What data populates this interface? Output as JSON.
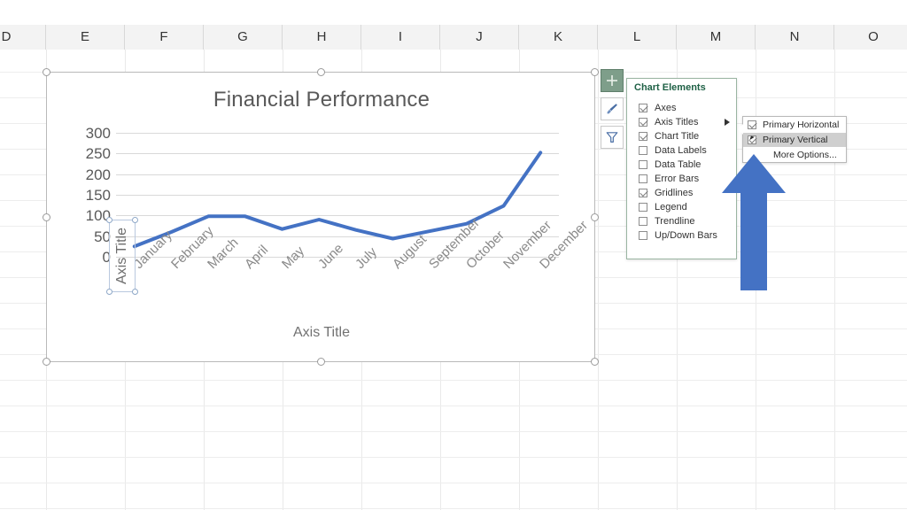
{
  "spreadsheet": {
    "column_headers": [
      "D",
      "E",
      "F",
      "G",
      "H",
      "I",
      "J",
      "K",
      "L",
      "M",
      "N",
      "O"
    ]
  },
  "chart": {
    "title": "Financial Performance",
    "x_axis_title": "Axis Title",
    "y_axis_title": "Axis Title",
    "y_axis_title_selected": true
  },
  "chart_data": {
    "type": "line",
    "title": "Financial Performance",
    "xlabel": "Axis Title",
    "ylabel": "Axis Title",
    "categories": [
      "January",
      "February",
      "March",
      "April",
      "May",
      "June",
      "July",
      "August",
      "September",
      "October",
      "November",
      "December"
    ],
    "values": [
      25,
      60,
      98,
      98,
      67,
      90,
      65,
      44,
      62,
      80,
      123,
      252
    ],
    "ylim": [
      0,
      300
    ],
    "yticks": [
      "0",
      "50",
      "100",
      "150",
      "200",
      "250",
      "300"
    ],
    "grid": true,
    "legend": "none",
    "series_color": "#4472C4"
  },
  "side_buttons": [
    {
      "name": "chart-elements",
      "icon": "plus-icon",
      "active": true
    },
    {
      "name": "chart-styles",
      "icon": "paintbrush-icon",
      "active": false
    },
    {
      "name": "chart-filters",
      "icon": "funnel-icon",
      "active": false
    }
  ],
  "chart_elements_panel": {
    "heading": "Chart Elements",
    "items": [
      {
        "label": "Axes",
        "checked": true,
        "has_submenu": false
      },
      {
        "label": "Axis Titles",
        "checked": true,
        "has_submenu": true
      },
      {
        "label": "Chart Title",
        "checked": true,
        "has_submenu": false
      },
      {
        "label": "Data Labels",
        "checked": false,
        "has_submenu": false
      },
      {
        "label": "Data Table",
        "checked": false,
        "has_submenu": false
      },
      {
        "label": "Error Bars",
        "checked": false,
        "has_submenu": false
      },
      {
        "label": "Gridlines",
        "checked": true,
        "has_submenu": false
      },
      {
        "label": "Legend",
        "checked": false,
        "has_submenu": false
      },
      {
        "label": "Trendline",
        "checked": false,
        "has_submenu": false
      },
      {
        "label": "Up/Down Bars",
        "checked": false,
        "has_submenu": false
      }
    ]
  },
  "axis_titles_submenu": {
    "items": [
      {
        "label": "Primary Horizontal",
        "checked": true,
        "highlighted": false,
        "type": "checkbox"
      },
      {
        "label": "Primary Vertical",
        "checked": true,
        "highlighted": true,
        "type": "checkbox"
      },
      {
        "label": "More Options...",
        "checked": false,
        "highlighted": false,
        "type": "plain"
      }
    ]
  },
  "annotation": {
    "arrow_color": "#4472C4",
    "arrow_direction": "up"
  }
}
